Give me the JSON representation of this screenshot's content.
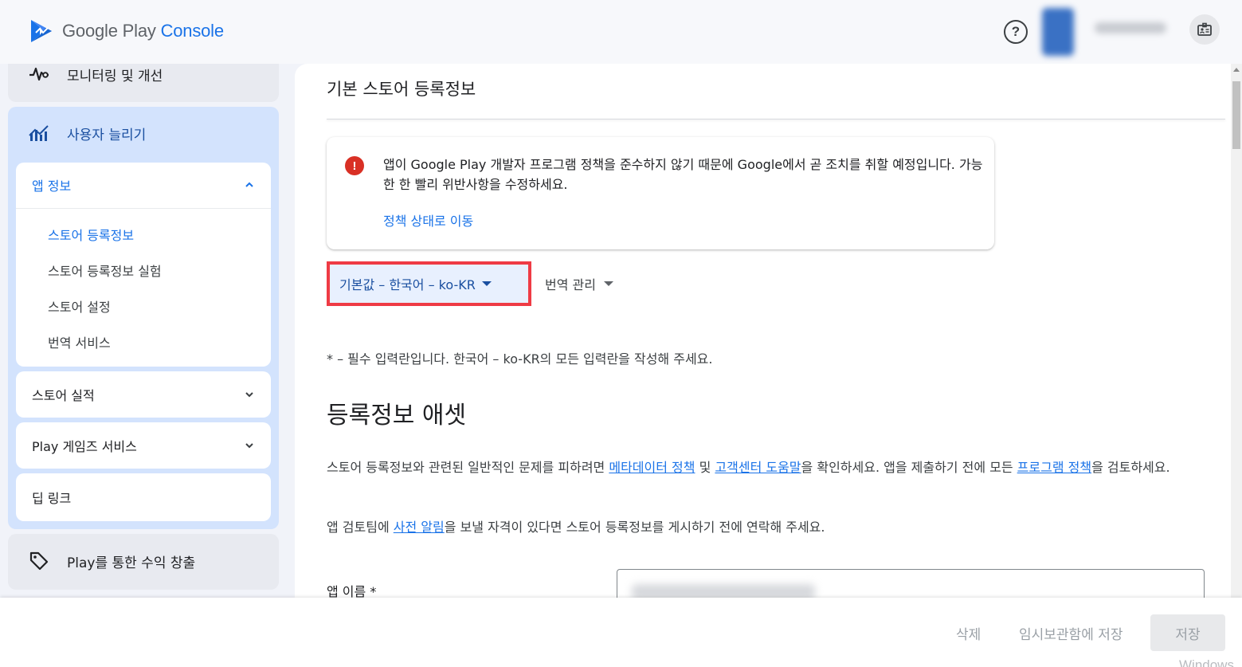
{
  "header": {
    "logo_text_1": "Google Play",
    "logo_text_2": "Console",
    "help_icon": "help-circle-icon",
    "account_icon": "account-badge-icon"
  },
  "sidebar": {
    "monitoring_label": "모니터링 및 개선",
    "grow_label": "사용자 늘리기",
    "app_info": {
      "label": "앱 정보",
      "items": [
        "스토어 등록정보",
        "스토어 등록정보 실험",
        "스토어 설정",
        "번역 서비스"
      ]
    },
    "store_performance_label": "스토어 실적",
    "play_games_label": "Play 게임즈 서비스",
    "deep_links_label": "딥 링크",
    "monetize_label": "Play를 통한 수익 창출"
  },
  "main": {
    "title": "기본 스토어 등록정보",
    "alert": {
      "text": "앱이 Google Play 개발자 프로그램 정책을 준수하지 않기 때문에 Google에서 곧 조치를 취할 예정입니다. 가능한 한 빨리 위반사항을 수정하세요.",
      "link": "정책 상태로 이동"
    },
    "language_button": "기본값 – 한국어 – ko-KR",
    "translations_button": "번역 관리",
    "required_note": "* – 필수 입력란입니다. 한국어 – ko-KR의 모든 입력란을 작성해 주세요.",
    "section_title": "등록정보 애셋",
    "para1": {
      "t1": "스토어 등록정보와 관련된 일반적인 문제를 피하려면 ",
      "link1": "메타데이터 정책",
      "t2": " 및 ",
      "link2": "고객센터 도움말",
      "t3": "을 확인하세요. 앱을 제출하기 전에 모든 ",
      "link3": "프로그램 정책",
      "t4": "을 검토하세요."
    },
    "para2": {
      "t1": "앱 검토팀에 ",
      "link1": "사전 알림",
      "t2": "을 보낼 자격이 있다면 스토어 등록정보를 게시하기 전에 연락해 주세요."
    },
    "app_name_label": "앱 이름 *"
  },
  "footer": {
    "delete": "삭제",
    "save_draft": "임시보관함에 저장",
    "save": "저장"
  },
  "watermark": "Windows",
  "colors": {
    "accent": "#1a73e8",
    "error": "#d93025",
    "highlight_border": "#ef3b45",
    "selected_bg": "#d3e3fd"
  }
}
